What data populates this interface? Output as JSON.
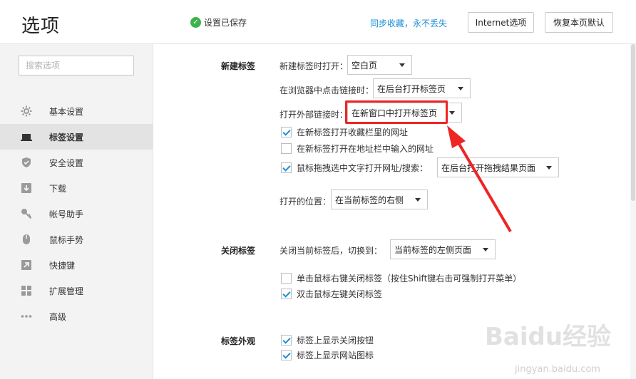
{
  "header": {
    "title": "选项",
    "saved_status": "设置已保存",
    "sync_link": "同步收藏，永不丢失",
    "internet_options": "Internet选项",
    "restore_defaults": "恢复本页默认"
  },
  "sidebar": {
    "search_placeholder": "搜索选项",
    "items": [
      {
        "label": "基本设置",
        "icon": "gear-icon"
      },
      {
        "label": "标签设置",
        "icon": "tab-icon",
        "active": true
      },
      {
        "label": "安全设置",
        "icon": "shield-icon"
      },
      {
        "label": "下载",
        "icon": "download-icon"
      },
      {
        "label": "帐号助手",
        "icon": "key-icon"
      },
      {
        "label": "鼠标手势",
        "icon": "mouse-icon"
      },
      {
        "label": "快捷键",
        "icon": "shortcut-arrow-icon"
      },
      {
        "label": "扩展管理",
        "icon": "extensions-grid-icon"
      },
      {
        "label": "高级",
        "icon": "more-dots-icon"
      }
    ]
  },
  "new_tab": {
    "title": "新建标签",
    "open_new_tab_label": "新建标签时打开：",
    "open_new_tab_value": "空白页",
    "click_link_label": "在浏览器中点击链接时：",
    "click_link_value": "在后台打开标签页",
    "external_link_label": "打开外部链接时：",
    "external_link_value": "在新窗口中打开标签页",
    "cb_favorites": "在新标签打开收藏栏里的网址",
    "cb_address_bar": "在新标签打开在地址栏中输入的网址",
    "cb_drag_label": "鼠标拖拽选中文字打开网址/搜索：",
    "drag_value": "在后台打开拖拽结果页面",
    "position_label": "打开的位置：",
    "position_value": "在当前标签的右侧"
  },
  "close_tab": {
    "title": "关闭标签",
    "switch_label": "关闭当前标签后，切换到：",
    "switch_value": "当前标签的左侧页面",
    "cb_right_click": "单击鼠标右键关闭标签（按住Shift键右击可强制打开菜单）",
    "cb_double_click": "双击鼠标左键关闭标签"
  },
  "tab_look": {
    "title": "标签外观",
    "cb_close_button": "标签上显示关闭按钮",
    "cb_site_icon": "标签上显示网站图标"
  },
  "watermark": {
    "brand": "Baidu经验",
    "url": "jingyan.baidu.com"
  },
  "colors": {
    "accent": "#1a8fd8",
    "annotation": "#ee2525",
    "saved_check": "#3cb34a"
  }
}
